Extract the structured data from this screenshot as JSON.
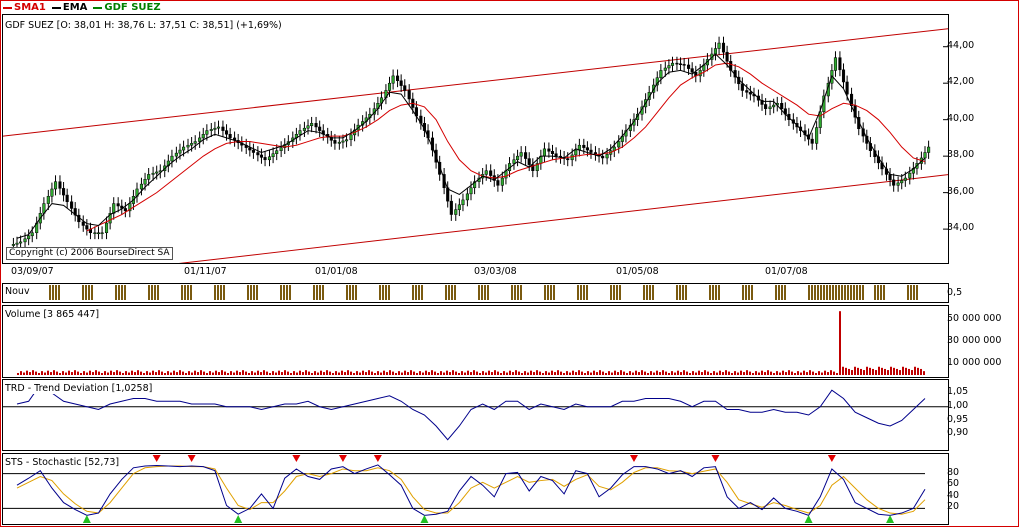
{
  "legend": [
    {
      "name": "SMA1",
      "color": "#d40000"
    },
    {
      "name": "EMA",
      "color": "#000000"
    },
    {
      "name": "GDF SUEZ",
      "color": "#008000"
    }
  ],
  "main": {
    "title": "GDF SUEZ [O: 38,01  H: 38,76  L: 37,51  C: 38,51] (+1,69%)",
    "copyright": "Copyright (c) 2006 BourseDirect SA",
    "y_ticks": [
      "44,00",
      "42,00",
      "40,00",
      "38,00",
      "36,00",
      "34,00"
    ],
    "x_ticks": [
      "03/09/07",
      "01/11/07",
      "01/01/08",
      "03/03/08",
      "01/05/08",
      "01/07/08"
    ]
  },
  "nouv": {
    "title": "Nouv",
    "tick": "0,5"
  },
  "volume": {
    "title": "Volume [3 865 447]",
    "ticks": [
      "50 000 000",
      "30 000 000",
      "10 000 000"
    ]
  },
  "trd": {
    "title": "TRD - Trend Deviation [1,0258]",
    "ticks": [
      "1,05",
      "1,00",
      "0,95",
      "0,90"
    ]
  },
  "sto": {
    "title": "STS - Stochastic [52,73]",
    "ticks": [
      "80",
      "60",
      "40",
      "20"
    ]
  },
  "chart_data": {
    "type": "line",
    "title": "GDF SUEZ",
    "x_categories": [
      "03/09/07",
      "01/11/07",
      "01/01/08",
      "03/03/08",
      "01/05/08",
      "01/07/08"
    ],
    "ylim": [
      32.8,
      45.3
    ],
    "series": [
      {
        "name": "GDF SUEZ",
        "type": "candlestick",
        "values": [
          33.3,
          33.8,
          35.4,
          36.6,
          35.5,
          34.4,
          33.8,
          33.8,
          35.4,
          35.0,
          36.2,
          37.0,
          37.2,
          38.0,
          38.5,
          38.8,
          39.4,
          39.6,
          39.0,
          38.6,
          38.2,
          37.8,
          38.3,
          38.8,
          39.4,
          39.8,
          39.2,
          38.7,
          38.9,
          39.7,
          40.3,
          41.2,
          42.4,
          41.6,
          40.2,
          39.0,
          37.0,
          34.8,
          35.6,
          36.6,
          37.2,
          36.4,
          37.6,
          38.2,
          37.2,
          38.4,
          38.0,
          37.8,
          38.6,
          38.2,
          37.9,
          38.5,
          39.4,
          40.3,
          41.5,
          42.7,
          43.1,
          43.0,
          42.4,
          43.3,
          44.2,
          42.7,
          41.6,
          41.3,
          40.6,
          40.9,
          40.0,
          39.4,
          38.7,
          41.3,
          43.4,
          41.4,
          39.5,
          38.3,
          37.3,
          36.4,
          36.8,
          37.6,
          38.5
        ]
      },
      {
        "name": "EMA",
        "values": [
          33.5,
          33.7,
          34.6,
          35.4,
          35.3,
          34.8,
          34.3,
          34.2,
          34.8,
          35.1,
          35.6,
          36.3,
          36.9,
          37.5,
          38.0,
          38.4,
          38.9,
          39.2,
          39.0,
          38.8,
          38.5,
          38.2,
          38.4,
          38.6,
          39.0,
          39.4,
          39.3,
          39.0,
          39.0,
          39.4,
          39.9,
          40.6,
          41.5,
          41.4,
          40.5,
          39.5,
          38.0,
          36.2,
          35.9,
          36.4,
          36.9,
          36.7,
          37.2,
          37.7,
          37.4,
          38.0,
          38.0,
          37.9,
          38.4,
          38.2,
          38.0,
          38.4,
          39.1,
          39.9,
          40.9,
          42.0,
          42.6,
          42.7,
          42.5,
          43.0,
          43.6,
          43.0,
          42.2,
          41.6,
          41.0,
          41.0,
          40.3,
          39.7,
          39.0,
          40.5,
          42.4,
          41.7,
          40.3,
          39.0,
          37.9,
          37.0,
          36.9,
          37.3,
          37.9
        ]
      },
      {
        "name": "SMA1",
        "values": [
          null,
          null,
          null,
          null,
          null,
          null,
          33.9,
          34.2,
          34.5,
          34.8,
          35.2,
          35.6,
          36.0,
          36.5,
          37.0,
          37.5,
          38.0,
          38.4,
          38.7,
          38.8,
          38.8,
          38.7,
          38.6,
          38.5,
          38.6,
          38.8,
          39.0,
          39.1,
          39.1,
          39.3,
          39.6,
          40.0,
          40.5,
          40.8,
          40.9,
          40.7,
          40.0,
          38.8,
          37.8,
          37.2,
          36.9,
          36.8,
          36.9,
          37.2,
          37.4,
          37.6,
          37.8,
          37.9,
          38.0,
          38.1,
          38.1,
          38.2,
          38.5,
          39.0,
          39.6,
          40.4,
          41.2,
          41.9,
          42.3,
          42.6,
          43.0,
          43.1,
          42.9,
          42.5,
          42.0,
          41.6,
          41.2,
          40.8,
          40.3,
          40.2,
          40.6,
          40.9,
          40.8,
          40.5,
          40.0,
          39.3,
          38.5,
          37.9,
          37.7
        ]
      }
    ],
    "trend_channel": {
      "upper": [
        [
          0,
          39.1
        ],
        [
          78,
          44.9
        ]
      ],
      "lower": [
        [
          0,
          31.0
        ],
        [
          78,
          36.9
        ]
      ]
    },
    "nouv_markers": {
      "ylim": [
        0,
        1
      ],
      "tick": 0.5
    },
    "volume": {
      "ylim": [
        0,
        60000000
      ],
      "last": 3865447,
      "spike_value": 58000000,
      "base_value": 3000000
    },
    "trend_deviation": {
      "ylim": [
        0.85,
        1.09
      ],
      "last": 1.0258,
      "values": [
        1.01,
        1.02,
        1.08,
        1.05,
        1.02,
        1.01,
        1.0,
        0.99,
        1.01,
        1.02,
        1.03,
        1.03,
        1.02,
        1.02,
        1.02,
        1.01,
        1.01,
        1.01,
        1.0,
        1.0,
        1.0,
        0.99,
        1.0,
        1.01,
        1.01,
        1.02,
        1.0,
        0.99,
        1.0,
        1.01,
        1.02,
        1.03,
        1.04,
        1.02,
        0.99,
        0.97,
        0.93,
        0.88,
        0.93,
        0.99,
        1.01,
        0.99,
        1.02,
        1.02,
        0.99,
        1.01,
        1.0,
        0.99,
        1.01,
        1.0,
        1.0,
        1.0,
        1.02,
        1.02,
        1.03,
        1.03,
        1.03,
        1.02,
        1.0,
        1.02,
        1.02,
        0.99,
        0.99,
        0.98,
        0.98,
        0.99,
        0.98,
        0.98,
        0.97,
        1.0,
        1.06,
        1.03,
        0.98,
        0.96,
        0.94,
        0.93,
        0.95,
        0.99,
        1.03
      ]
    },
    "stochastic": {
      "ylim": [
        0,
        100
      ],
      "levels": [
        20,
        80
      ],
      "last": 52.73,
      "k": [
        60,
        72,
        85,
        55,
        30,
        18,
        8,
        12,
        45,
        70,
        90,
        93,
        94,
        93,
        92,
        93,
        92,
        85,
        25,
        10,
        20,
        45,
        20,
        72,
        88,
        75,
        70,
        88,
        92,
        80,
        88,
        95,
        78,
        60,
        20,
        8,
        10,
        15,
        50,
        75,
        60,
        40,
        80,
        82,
        50,
        75,
        68,
        45,
        85,
        80,
        40,
        55,
        78,
        92,
        92,
        88,
        80,
        85,
        75,
        90,
        92,
        40,
        20,
        30,
        18,
        38,
        20,
        15,
        8,
        40,
        88,
        70,
        30,
        20,
        10,
        8,
        12,
        20,
        53
      ],
      "d": [
        55,
        65,
        75,
        68,
        45,
        28,
        15,
        12,
        30,
        55,
        80,
        90,
        92,
        93,
        93,
        92,
        92,
        88,
        55,
        25,
        18,
        30,
        30,
        50,
        75,
        80,
        75,
        80,
        88,
        85,
        85,
        90,
        85,
        70,
        40,
        18,
        12,
        12,
        30,
        55,
        65,
        55,
        65,
        75,
        65,
        68,
        70,
        58,
        70,
        78,
        58,
        52,
        65,
        82,
        90,
        90,
        85,
        84,
        80,
        84,
        88,
        65,
        35,
        28,
        22,
        30,
        25,
        18,
        12,
        25,
        60,
        75,
        55,
        35,
        20,
        12,
        10,
        15,
        35
      ]
    }
  }
}
